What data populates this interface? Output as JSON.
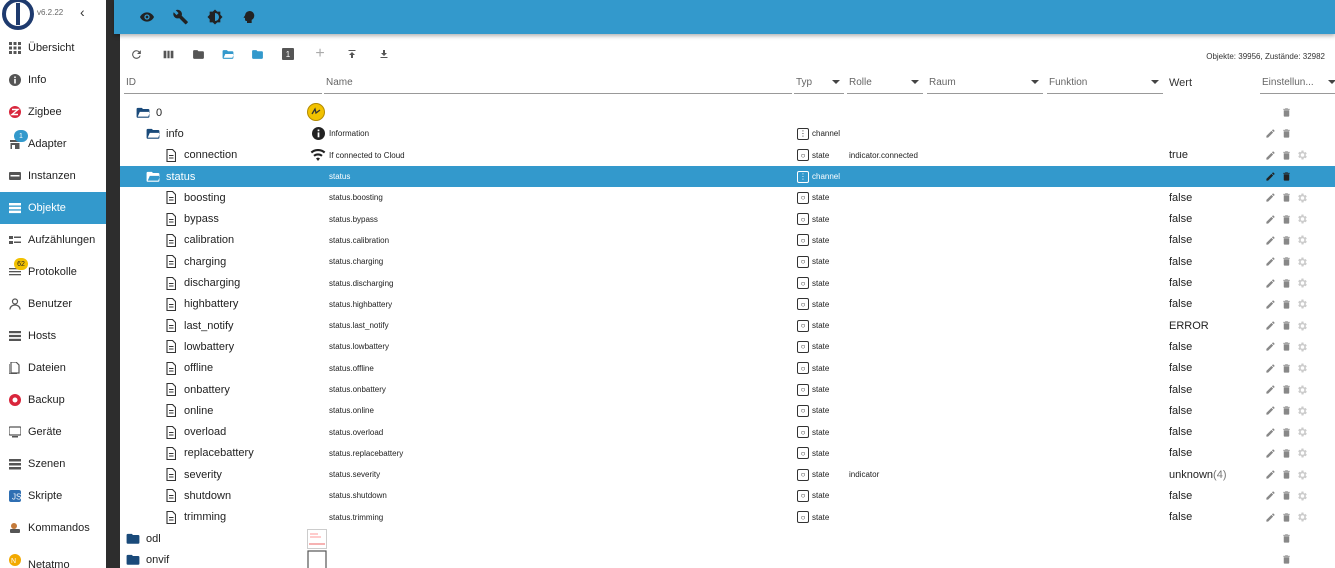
{
  "app": {
    "version": "v6.2.22",
    "collapse_label": "‹"
  },
  "sidebar": {
    "items": [
      {
        "label": "Übersicht",
        "icon": "apps-grid-icon"
      },
      {
        "label": "Info",
        "icon": "info-icon"
      },
      {
        "label": "Zigbee",
        "icon": "zigbee-icon"
      },
      {
        "label": "Adapter",
        "icon": "store-icon",
        "badge": "1"
      },
      {
        "label": "Instanzen",
        "icon": "instances-icon"
      },
      {
        "label": "Objekte",
        "icon": "list-icon",
        "active": true
      },
      {
        "label": "Aufzählungen",
        "icon": "enums-icon"
      },
      {
        "label": "Protokolle",
        "icon": "log-icon",
        "badge": "62"
      },
      {
        "label": "Benutzer",
        "icon": "user-icon"
      },
      {
        "label": "Hosts",
        "icon": "hosts-icon"
      },
      {
        "label": "Dateien",
        "icon": "files-icon"
      },
      {
        "label": "Backup",
        "icon": "backup-icon"
      },
      {
        "label": "Geräte",
        "icon": "devices-icon"
      },
      {
        "label": "Szenen",
        "icon": "scenes-icon"
      },
      {
        "label": "Skripte",
        "icon": "scripts-icon"
      },
      {
        "label": "Kommandos",
        "icon": "commands-icon"
      },
      {
        "label": "Netatmo",
        "icon": "netatmo-icon"
      }
    ]
  },
  "toolbar": {
    "object_count": "Objekte: 39956, Zustände: 32982",
    "filter_badge": "1"
  },
  "table": {
    "headers": {
      "id": "ID",
      "name": "Name",
      "type": "Typ",
      "role": "Rolle",
      "room": "Raum",
      "function": "Funktion",
      "value": "Wert",
      "settings": "Einstellun..."
    },
    "rows": [
      {
        "level": 1,
        "kind": "folder-open",
        "id": "0",
        "name": "",
        "type": "",
        "role": "",
        "value": "",
        "thumb": "meter",
        "edit": false
      },
      {
        "level": 2,
        "kind": "folder-open",
        "id": "info",
        "name": "Information",
        "name_icon": "info",
        "type": "channel",
        "role": "",
        "value": "",
        "edit": true,
        "gear": false
      },
      {
        "level": 3,
        "kind": "file",
        "id": "connection",
        "name": "If connected to Cloud",
        "name_icon": "wifi",
        "type": "state",
        "role": "indicator.connected",
        "value": "true",
        "edit": true,
        "gear": true
      },
      {
        "level": 2,
        "kind": "folder-open",
        "id": "status",
        "name": "status",
        "type": "channel",
        "role": "",
        "value": "",
        "edit": true,
        "gear": false,
        "selected": true
      },
      {
        "level": 3,
        "kind": "file",
        "id": "boosting",
        "name": "status.boosting",
        "type": "state",
        "role": "",
        "value": "false",
        "edit": true,
        "gear": true
      },
      {
        "level": 3,
        "kind": "file",
        "id": "bypass",
        "name": "status.bypass",
        "type": "state",
        "role": "",
        "value": "false",
        "edit": true,
        "gear": true
      },
      {
        "level": 3,
        "kind": "file",
        "id": "calibration",
        "name": "status.calibration",
        "type": "state",
        "role": "",
        "value": "false",
        "edit": true,
        "gear": true
      },
      {
        "level": 3,
        "kind": "file",
        "id": "charging",
        "name": "status.charging",
        "type": "state",
        "role": "",
        "value": "false",
        "edit": true,
        "gear": true
      },
      {
        "level": 3,
        "kind": "file",
        "id": "discharging",
        "name": "status.discharging",
        "type": "state",
        "role": "",
        "value": "false",
        "edit": true,
        "gear": true
      },
      {
        "level": 3,
        "kind": "file",
        "id": "highbattery",
        "name": "status.highbattery",
        "type": "state",
        "role": "",
        "value": "false",
        "edit": true,
        "gear": true
      },
      {
        "level": 3,
        "kind": "file",
        "id": "last_notify",
        "name": "status.last_notify",
        "type": "state",
        "role": "",
        "value": "ERROR",
        "edit": true,
        "gear": true
      },
      {
        "level": 3,
        "kind": "file",
        "id": "lowbattery",
        "name": "status.lowbattery",
        "type": "state",
        "role": "",
        "value": "false",
        "edit": true,
        "gear": true
      },
      {
        "level": 3,
        "kind": "file",
        "id": "offline",
        "name": "status.offline",
        "type": "state",
        "role": "",
        "value": "false",
        "edit": true,
        "gear": true
      },
      {
        "level": 3,
        "kind": "file",
        "id": "onbattery",
        "name": "status.onbattery",
        "type": "state",
        "role": "",
        "value": "false",
        "edit": true,
        "gear": true
      },
      {
        "level": 3,
        "kind": "file",
        "id": "online",
        "name": "status.online",
        "type": "state",
        "role": "",
        "value": "false",
        "edit": true,
        "gear": true
      },
      {
        "level": 3,
        "kind": "file",
        "id": "overload",
        "name": "status.overload",
        "type": "state",
        "role": "",
        "value": "false",
        "edit": true,
        "gear": true
      },
      {
        "level": 3,
        "kind": "file",
        "id": "replacebattery",
        "name": "status.replacebattery",
        "type": "state",
        "role": "",
        "value": "false",
        "edit": true,
        "gear": true
      },
      {
        "level": 3,
        "kind": "file",
        "id": "severity",
        "name": "status.severity",
        "type": "state",
        "role": "indicator",
        "value": "unknown",
        "value_suffix": "(4)",
        "edit": true,
        "gear": true
      },
      {
        "level": 3,
        "kind": "file",
        "id": "shutdown",
        "name": "status.shutdown",
        "type": "state",
        "role": "",
        "value": "false",
        "edit": true,
        "gear": true
      },
      {
        "level": 3,
        "kind": "file",
        "id": "trimming",
        "name": "status.trimming",
        "type": "state",
        "role": "",
        "value": "false",
        "edit": true,
        "gear": true
      },
      {
        "level": 0,
        "kind": "folder",
        "id": "odl",
        "name": "",
        "type": "",
        "role": "",
        "value": "",
        "thumb": "chart",
        "edit": false
      },
      {
        "level": 0,
        "kind": "folder",
        "id": "onvif",
        "name": "",
        "type": "",
        "role": "",
        "value": "",
        "thumb": "box",
        "edit": false
      }
    ]
  }
}
